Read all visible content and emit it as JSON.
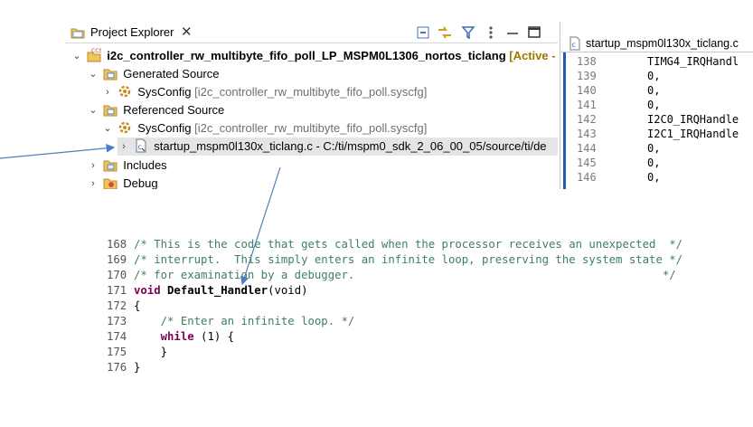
{
  "explorer": {
    "title": "Project Explorer",
    "close_glyph": "✕",
    "toolbar_icons": [
      "collapse-all-icon",
      "link-with-editor-icon",
      "filter-icon",
      "view-menu-icon",
      "minimize-icon"
    ],
    "tree": [
      {
        "label": "i2c_controller_rw_multibyte_fifo_poll_LP_MSPM0L1306_nortos_ticlang",
        "note": "[Active -",
        "expanded": true,
        "icon": "ccs-project-icon"
      },
      {
        "label": "Generated Source",
        "expanded": true,
        "icon": "source-folder-icon"
      },
      {
        "label": "SysConfig",
        "detail": "[i2c_controller_rw_multibyte_fifo_poll.syscfg]",
        "expanded": false,
        "icon": "sysconfig-icon"
      },
      {
        "label": "Referenced Source",
        "expanded": true,
        "icon": "source-folder-icon"
      },
      {
        "label": "SysConfig",
        "detail": "[i2c_controller_rw_multibyte_fifo_poll.syscfg]",
        "expanded": true,
        "icon": "sysconfig-icon"
      },
      {
        "label": "startup_mspm0l130x_ticlang.c - C:/ti/mspm0_sdk_2_06_00_05/source/ti/de",
        "expanded": false,
        "icon": "c-file-link-icon"
      },
      {
        "label": "Includes",
        "expanded": false,
        "icon": "includes-icon"
      },
      {
        "label": "Debug",
        "expanded": false,
        "icon": "debug-folder-icon"
      }
    ]
  },
  "side_editor": {
    "tab_title": "startup_mspm0l130x_ticlang.c",
    "lines": [
      {
        "n": "138",
        "t": "TIMG4_IRQHandl"
      },
      {
        "n": "139",
        "t": "0,"
      },
      {
        "n": "140",
        "t": "0,"
      },
      {
        "n": "141",
        "t": "0,"
      },
      {
        "n": "142",
        "t": "I2C0_IRQHandle"
      },
      {
        "n": "143",
        "t": "I2C1_IRQHandle"
      },
      {
        "n": "144",
        "t": "0,"
      },
      {
        "n": "145",
        "t": "0,"
      },
      {
        "n": "146",
        "t": "0,"
      }
    ]
  },
  "code": {
    "lines": [
      {
        "n": "168",
        "t": "/* This is the code that gets called when the processor receives an unexpected  */"
      },
      {
        "n": "169",
        "t": "/* interrupt.  This simply enters an infinite loop, preserving the system state */"
      },
      {
        "n": "170",
        "t": "/* for examination by a debugger.                                              */"
      },
      {
        "n": "171",
        "kw": "void",
        "fn": "Default_Handler",
        "rest": "(void)"
      },
      {
        "n": "172",
        "t": "{"
      },
      {
        "n": "173",
        "t": "    /* Enter an infinite loop. */"
      },
      {
        "n": "174",
        "kw": "while",
        "rest": " (1) {"
      },
      {
        "n": "175",
        "t": "    }"
      },
      {
        "n": "176",
        "t": "}"
      }
    ]
  },
  "colors": {
    "comment": "#3f7f5f",
    "keyword": "#7f0055",
    "annotation_arrow": "#4a7fc1",
    "active_note": "#9b7a00"
  }
}
